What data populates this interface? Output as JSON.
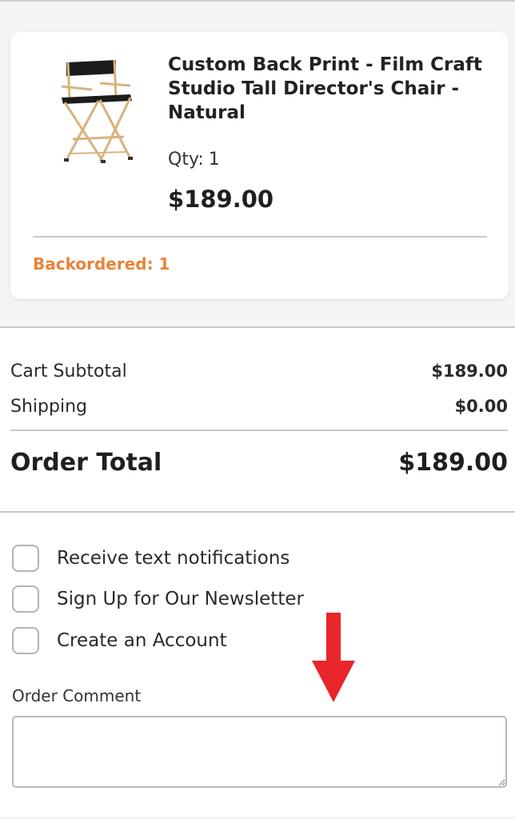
{
  "product": {
    "name": "Custom Back Print - Film Craft Studio Tall Director's Chair - Natural",
    "qty_label": "Qty:",
    "qty_value": "1",
    "price": "$189.00",
    "backorder": "Backordered: 1",
    "image_icon": "director-chair-image"
  },
  "summary": {
    "subtotal_label": "Cart Subtotal",
    "subtotal_value": "$189.00",
    "shipping_label": "Shipping",
    "shipping_value": "$0.00",
    "total_label": "Order Total",
    "total_value": "$189.00"
  },
  "options": {
    "sms_label": "Receive text notifications",
    "newsletter_label": "Sign Up for Our Newsletter",
    "account_label": "Create an Account"
  },
  "comment": {
    "label": "Order Comment",
    "value": ""
  },
  "colors": {
    "backorder": "#e8833a",
    "arrow": "#e8262b"
  }
}
